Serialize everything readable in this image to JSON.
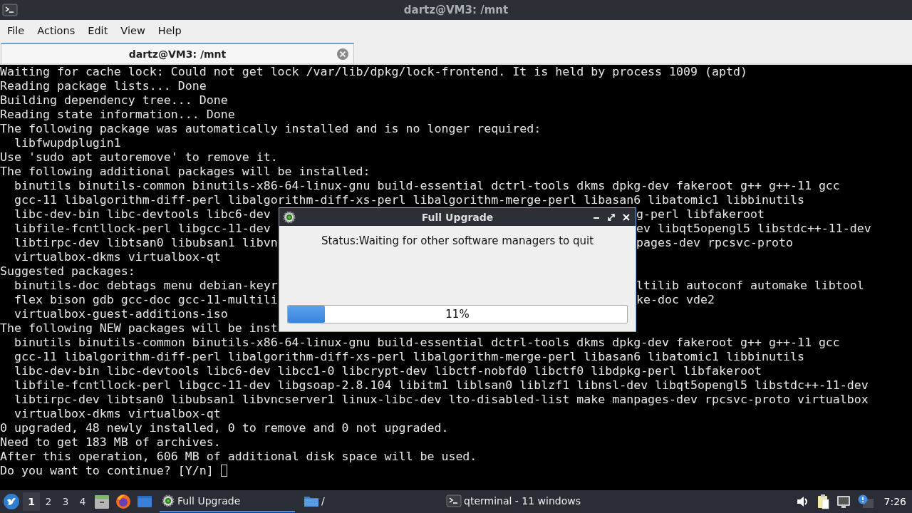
{
  "window": {
    "title": "dartz@VM3: /mnt"
  },
  "menu": [
    "File",
    "Actions",
    "Edit",
    "View",
    "Help"
  ],
  "tabs": [
    {
      "label": "dartz@VM3: /mnt",
      "selected": true
    }
  ],
  "terminal": {
    "lines": [
      {
        "text": "Waiting for cache lock: Could not get lock /var/lib/dpkg/lock-frontend. It is held by process 1009 (aptd)"
      },
      {
        "text": "Reading package lists... Done"
      },
      {
        "text": "Building dependency tree... Done"
      },
      {
        "text": "Reading state information... Done"
      },
      {
        "text": "The following package was automatically installed and is no longer required:"
      },
      {
        "text": "  libfwupdplugin1"
      },
      {
        "text": "Use 'sudo apt autoremove' to remove it."
      },
      {
        "text": "The following additional packages will be installed:"
      },
      {
        "text": "  binutils binutils-common binutils-x86-64-linux-gnu build-essential dctrl-tools dkms dpkg-dev fakeroot g++ g++-11 gcc"
      },
      {
        "text": "  gcc-11 libalgorithm-diff-perl libalgorithm-diff-xs-perl libalgorithm-merge-perl libasan6 libatomic1 libbinutils"
      },
      {
        "left": "  libc-dev-bin libc-devtools libc6-dev",
        "right": "g-perl libfakeroot"
      },
      {
        "left": "  libfile-fcntllock-perl libgcc-11-dev",
        "right": "ev libqt5opengl5 libstdc++-11-dev"
      },
      {
        "left": "  libtirpc-dev libtsan0 libubsan1 libvn",
        "right": "pages-dev rpcsvc-proto"
      },
      {
        "text": "  virtualbox-dkms virtualbox-qt"
      },
      {
        "text": "Suggested packages:"
      },
      {
        "left": "  binutils-doc debtags menu debian-keyr",
        "right": "ltilib autoconf automake libtool"
      },
      {
        "left": "  flex bison gdb gcc-doc gcc-11-multili",
        "right": "ke-doc vde2"
      },
      {
        "text": "  virtualbox-guest-additions-iso"
      },
      {
        "left": "The following NEW packages will be inst"
      },
      {
        "text": "  binutils binutils-common binutils-x86-64-linux-gnu build-essential dctrl-tools dkms dpkg-dev fakeroot g++ g++-11 gcc"
      },
      {
        "text": "  gcc-11 libalgorithm-diff-perl libalgorithm-diff-xs-perl libalgorithm-merge-perl libasan6 libatomic1 libbinutils"
      },
      {
        "text": "  libc-dev-bin libc-devtools libc6-dev libcc1-0 libcrypt-dev libctf-nobfd0 libctf0 libdpkg-perl libfakeroot"
      },
      {
        "text": "  libfile-fcntllock-perl libgcc-11-dev libgsoap-2.8.104 libitm1 liblsan0 liblzf1 libnsl-dev libqt5opengl5 libstdc++-11-dev"
      },
      {
        "text": "  libtirpc-dev libtsan0 libubsan1 libvncserver1 linux-libc-dev lto-disabled-list make manpages-dev rpcsvc-proto virtualbox"
      },
      {
        "text": "  virtualbox-dkms virtualbox-qt"
      },
      {
        "text": "0 upgraded, 48 newly installed, 0 to remove and 0 not upgraded."
      },
      {
        "text": "Need to get 183 MB of archives."
      },
      {
        "text": "After this operation, 606 MB of additional disk space will be used."
      },
      {
        "text": "Do you want to continue? [Y/n] ",
        "cursor": true
      }
    ]
  },
  "dialog": {
    "title": "Full Upgrade",
    "status": "Status:Waiting for other software managers to quit",
    "progress": {
      "level": 0.11,
      "label": "11%"
    }
  },
  "taskbar": {
    "desktops": [
      {
        "label": "1",
        "selected": true
      },
      {
        "label": "2",
        "selected": false
      },
      {
        "label": "3",
        "selected": false
      },
      {
        "label": "4",
        "selected": false
      }
    ],
    "tasks": [
      {
        "label": "Full Upgrade",
        "kind": "gear",
        "selected": true
      },
      {
        "label": "/",
        "kind": "folder",
        "selected": false
      },
      {
        "label": "qterminal - 11 windows",
        "kind": "terminal",
        "selected": false
      }
    ],
    "clock": "7:26"
  }
}
